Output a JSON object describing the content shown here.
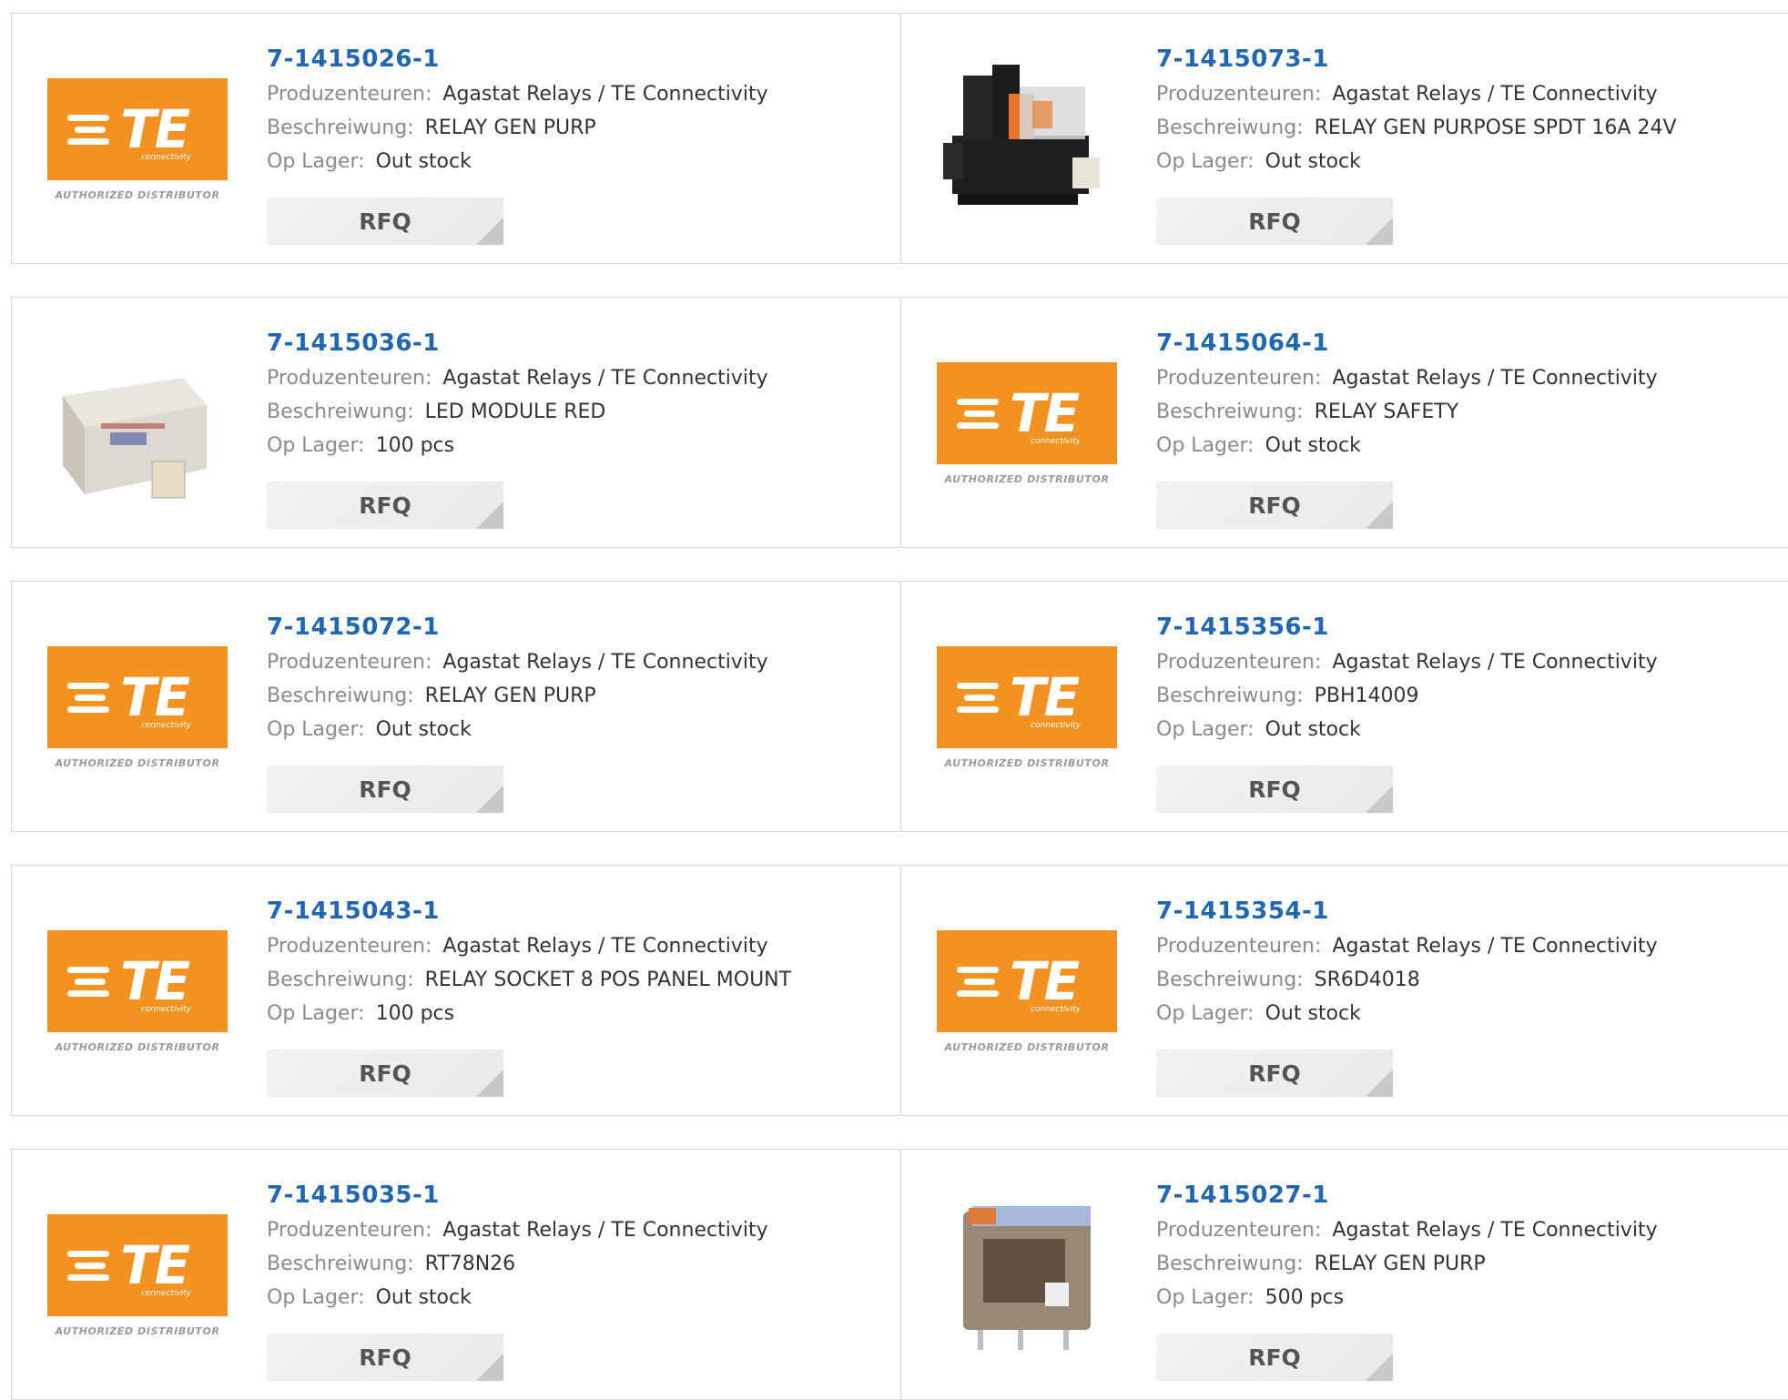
{
  "labels": {
    "manufacturer": "Produzenteuren:",
    "description": "Beschreiwung:",
    "stock": "Op Lager:",
    "rfq": "RFQ"
  },
  "colors": {
    "part_number": "#1f66b3",
    "label": "#8a8a8a",
    "te_orange": "#f39220",
    "rfq_bg": "#efefef"
  },
  "logo": {
    "brand": "TE",
    "tagline": "connectivity",
    "authorized": "AUTHORIZED DISTRIBUTOR"
  },
  "products": [
    {
      "part_number": "7-1415026-1",
      "manufacturer": "Agastat Relays / TE Connectivity",
      "description": "RELAY GEN PURP",
      "stock": "Out stock",
      "image": "te-logo"
    },
    {
      "part_number": "7-1415073-1",
      "manufacturer": "Agastat Relays / TE Connectivity",
      "description": "RELAY GEN PURPOSE SPDT 16A 24V",
      "stock": "Out stock",
      "image": "relay-socket-photo"
    },
    {
      "part_number": "7-1415036-1",
      "manufacturer": "Agastat Relays / TE Connectivity",
      "description": "LED MODULE RED",
      "stock": "100 pcs",
      "image": "led-module-photo"
    },
    {
      "part_number": "7-1415064-1",
      "manufacturer": "Agastat Relays / TE Connectivity",
      "description": "RELAY SAFETY",
      "stock": "Out stock",
      "image": "te-logo"
    },
    {
      "part_number": "7-1415072-1",
      "manufacturer": "Agastat Relays / TE Connectivity",
      "description": "RELAY GEN PURP",
      "stock": "Out stock",
      "image": "te-logo"
    },
    {
      "part_number": "7-1415356-1",
      "manufacturer": "Agastat Relays / TE Connectivity",
      "description": "PBH14009",
      "stock": "Out stock",
      "image": "te-logo"
    },
    {
      "part_number": "7-1415043-1",
      "manufacturer": "Agastat Relays / TE Connectivity",
      "description": "RELAY SOCKET 8 POS PANEL MOUNT",
      "stock": "100 pcs",
      "image": "te-logo"
    },
    {
      "part_number": "7-1415354-1",
      "manufacturer": "Agastat Relays / TE Connectivity",
      "description": "SR6D4018",
      "stock": "Out stock",
      "image": "te-logo"
    },
    {
      "part_number": "7-1415035-1",
      "manufacturer": "Agastat Relays / TE Connectivity",
      "description": "RT78N26",
      "stock": "Out stock",
      "image": "te-logo"
    },
    {
      "part_number": "7-1415027-1",
      "manufacturer": "Agastat Relays / TE Connectivity",
      "description": "RELAY GEN PURP",
      "stock": "500 pcs",
      "image": "relay-cube-photo"
    }
  ]
}
